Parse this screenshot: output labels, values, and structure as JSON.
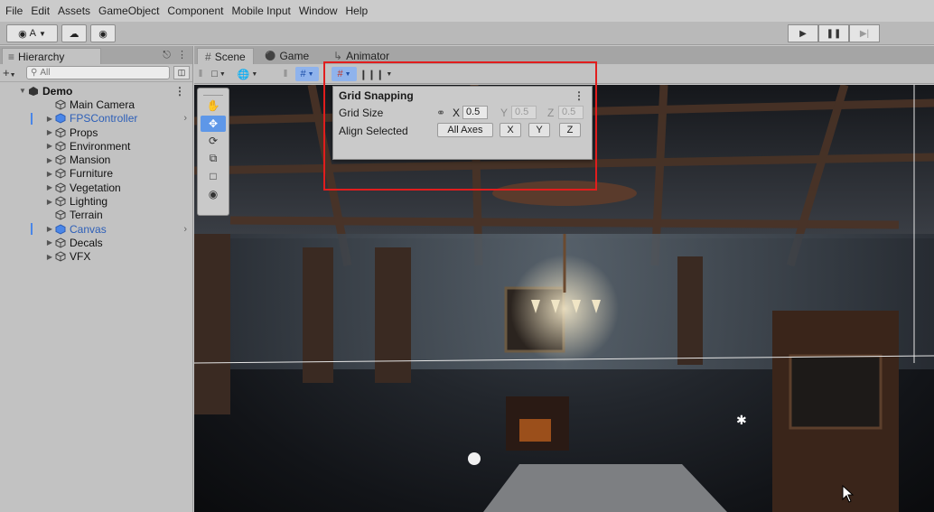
{
  "menu": [
    "File",
    "Edit",
    "Assets",
    "GameObject",
    "Component",
    "Mobile Input",
    "Window",
    "Help"
  ],
  "toolbar": {
    "account_label": "A"
  },
  "hierarchy": {
    "tab_label": "Hierarchy",
    "search_placeholder": "All",
    "items": [
      {
        "label": "Demo",
        "depth": 0,
        "root": true,
        "expanded": true
      },
      {
        "label": "Main Camera",
        "depth": 1
      },
      {
        "label": "FPSController",
        "depth": 1,
        "prefab": true,
        "has_children": true,
        "marker": true,
        "chevron": true
      },
      {
        "label": "Props",
        "depth": 1,
        "has_children": true
      },
      {
        "label": "Environment",
        "depth": 1,
        "has_children": true
      },
      {
        "label": "Mansion",
        "depth": 1,
        "has_children": true
      },
      {
        "label": "Furniture",
        "depth": 1,
        "has_children": true
      },
      {
        "label": "Vegetation",
        "depth": 1,
        "has_children": true
      },
      {
        "label": "Lighting",
        "depth": 1,
        "has_children": true
      },
      {
        "label": "Terrain",
        "depth": 1
      },
      {
        "label": "Canvas",
        "depth": 1,
        "prefab": true,
        "has_children": true,
        "marker": true,
        "chevron": true
      },
      {
        "label": "Decals",
        "depth": 1,
        "has_children": true
      },
      {
        "label": "VFX",
        "depth": 1,
        "has_children": true
      }
    ]
  },
  "scene": {
    "tabs": [
      {
        "label": "Scene",
        "icon": "#",
        "active": true
      },
      {
        "label": "Game",
        "icon": "oo"
      },
      {
        "label": "Animator",
        "icon": "~"
      }
    ]
  },
  "grid_snapping": {
    "title": "Grid Snapping",
    "grid_size_label": "Grid Size",
    "x_label": "X",
    "x_value": "0.5",
    "y_label": "Y",
    "y_value": "0.5",
    "z_label": "Z",
    "z_value": "0.5",
    "align_label": "Align Selected",
    "all_axes_label": "All Axes",
    "align_x_label": "X",
    "align_y_label": "Y",
    "align_z_label": "Z"
  },
  "colors": {
    "highlight": "#e11d1d",
    "selection": "#5e97e8",
    "prefab_text": "#2d5fb8"
  }
}
